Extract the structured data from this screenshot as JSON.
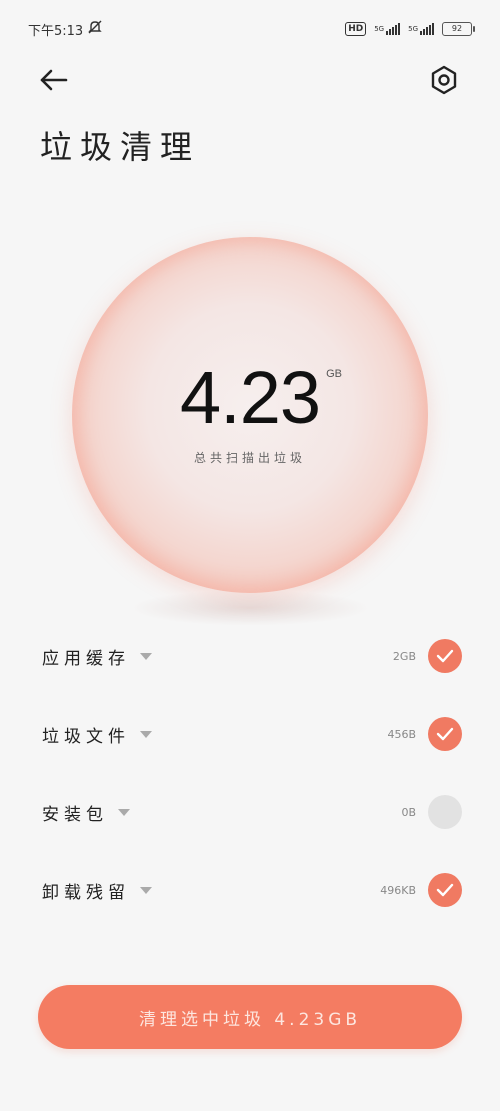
{
  "status_bar": {
    "time": "下午5:13",
    "hd_label": "HD",
    "net1": "5G",
    "net2": "5G",
    "battery": "92"
  },
  "header": {
    "title": "垃圾清理"
  },
  "summary": {
    "value": "4.23",
    "unit": "GB",
    "caption": "总共扫描出垃圾"
  },
  "items": [
    {
      "label": "应用缓存",
      "size": "2GB",
      "checked": true
    },
    {
      "label": "垃圾文件",
      "size": "456B",
      "checked": true
    },
    {
      "label": "安装包",
      "size": "0B",
      "checked": false
    },
    {
      "label": "卸载残留",
      "size": "496KB",
      "checked": true
    }
  ],
  "action": {
    "label": "清理选中垃圾 4.23GB"
  },
  "colors": {
    "accent": "#f47c62",
    "check_on": "#f07a62",
    "check_off": "#e2e2e2"
  }
}
